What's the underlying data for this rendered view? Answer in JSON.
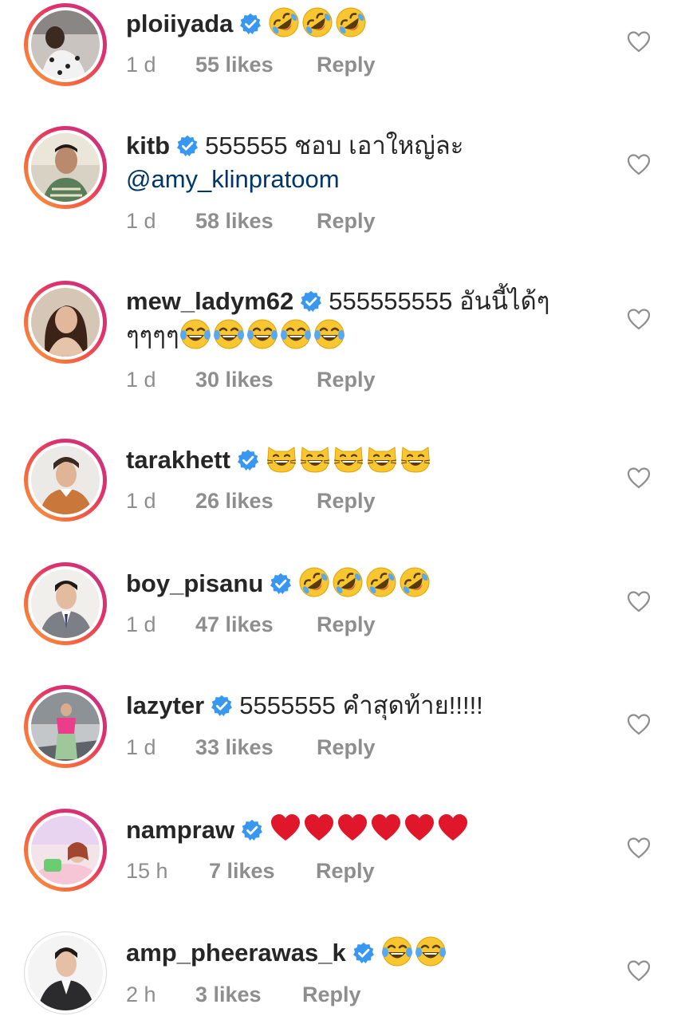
{
  "comments": [
    {
      "username": "ploiiyada",
      "text": "",
      "mention": "",
      "emoji": "rolling-laughing",
      "emoji_count": 3,
      "time": "1 d",
      "likes": "55 likes",
      "reply": "Reply"
    },
    {
      "username": "kitb",
      "text": "555555 ชอบ เอาใหญ่ละ",
      "mention": "@amy_klinpratoom",
      "emoji": "",
      "emoji_count": 0,
      "time": "1 d",
      "likes": "58 likes",
      "reply": "Reply"
    },
    {
      "username": "mew_ladym62",
      "text": "555555555 อันนี้ได้ๆ",
      "text2": "ๆๆๆๆ",
      "mention": "",
      "emoji": "tears-of-joy",
      "emoji_count": 5,
      "time": "1 d",
      "likes": "30 likes",
      "reply": "Reply"
    },
    {
      "username": "tarakhett",
      "text": "",
      "mention": "",
      "emoji": "grinning-cat",
      "emoji_count": 5,
      "time": "1 d",
      "likes": "26 likes",
      "reply": "Reply"
    },
    {
      "username": "boy_pisanu",
      "text": "",
      "mention": "",
      "emoji": "rolling-laughing",
      "emoji_count": 4,
      "time": "1 d",
      "likes": "47 likes",
      "reply": "Reply"
    },
    {
      "username": "lazyter",
      "text": "5555555 คำสุดท้าย!!!!!",
      "mention": "",
      "emoji": "",
      "emoji_count": 0,
      "time": "1 d",
      "likes": "33 likes",
      "reply": "Reply"
    },
    {
      "username": "nampraw",
      "text": "",
      "mention": "",
      "emoji": "red-heart",
      "emoji_count": 6,
      "time": "15 h",
      "likes": "7 likes",
      "reply": "Reply"
    },
    {
      "username": "amp_pheerawas_k",
      "text": "",
      "mention": "",
      "emoji": "tears-of-joy",
      "emoji_count": 2,
      "time": "2 h",
      "likes": "3 likes",
      "reply": "Reply"
    }
  ],
  "colors": {
    "verified": "#3897f0",
    "meta": "#8e8e8e",
    "mention": "#00376b",
    "ring_start": "#f9a03a",
    "ring_end": "#c13584"
  }
}
